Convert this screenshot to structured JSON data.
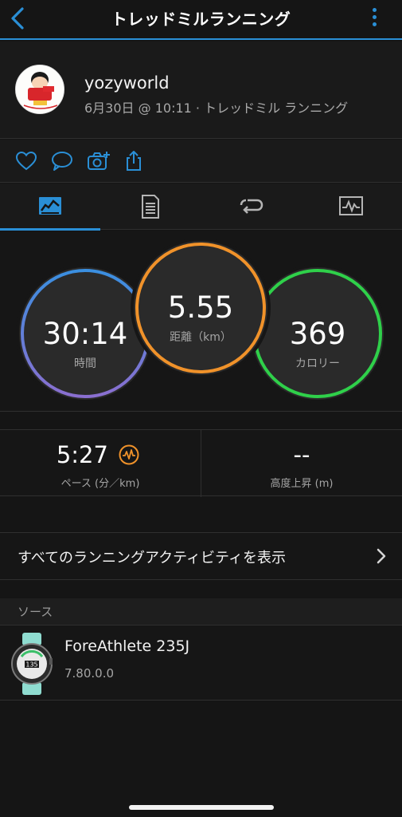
{
  "header": {
    "title": "トレッドミルランニング"
  },
  "profile": {
    "username": "yozyworld",
    "subline": "6月30日 @ 10:11 · トレッドミル ランニング"
  },
  "actions": [
    "heart-icon",
    "comment-icon",
    "camera-add-icon",
    "share-icon"
  ],
  "tabs": [
    {
      "name": "summary",
      "icon": "summary-chart-icon",
      "active": true
    },
    {
      "name": "details",
      "icon": "document-list-icon",
      "active": false
    },
    {
      "name": "laps",
      "icon": "laps-loop-icon",
      "active": false
    },
    {
      "name": "graphs",
      "icon": "graph-icon",
      "active": false
    }
  ],
  "summary": {
    "time": {
      "value": "30:14",
      "label": "時間"
    },
    "distance": {
      "value": "5.55",
      "label": "距離（km）"
    },
    "calories": {
      "value": "369",
      "label": "カロリー"
    }
  },
  "stats": {
    "pace": {
      "value": "5:27",
      "label": "ペース (分／km)"
    },
    "elevation": {
      "value": "--",
      "label": "高度上昇 (m)"
    }
  },
  "view_all": {
    "label": "すべてのランニングアクティビティを表示"
  },
  "source": {
    "header": "ソース",
    "device_name": "ForeAthlete 235J",
    "version": "7.80.0.0",
    "watch_face_number": "135"
  },
  "colors": {
    "accent": "#2a8fd6",
    "time_ring": [
      "#3a8fe0",
      "#8a6fd0"
    ],
    "distance_ring": "#f0922a",
    "calories_ring": "#2fd04a",
    "pace_badge": "#f0922a"
  }
}
